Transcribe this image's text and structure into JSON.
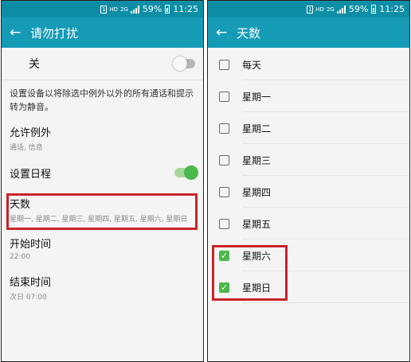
{
  "status_bar": {
    "sim": "1",
    "hd": "HD",
    "net": "2G",
    "battery": "59%",
    "time": "11:25"
  },
  "left_screen": {
    "title": "请勿打扰",
    "main_switch": {
      "label": "关",
      "on": false
    },
    "description": "设置设备以将除选中例外以外的所有通话和提示转为静音。",
    "exceptions": {
      "title": "允许例外",
      "summary": "通话, 信息"
    },
    "schedule": {
      "title": "设置日程",
      "on": true
    },
    "days": {
      "title": "天数",
      "summary": "星期一, 星期二, 星期三, 星期四, 星期五, 星期六, 星期日"
    },
    "start_time": {
      "title": "开始时间",
      "summary": "22:00"
    },
    "end_time": {
      "title": "结束时间",
      "summary": "次日 07:00"
    }
  },
  "right_screen": {
    "title": "天数",
    "items": [
      {
        "label": "每天",
        "checked": false
      },
      {
        "label": "星期一",
        "checked": false
      },
      {
        "label": "星期二",
        "checked": false
      },
      {
        "label": "星期三",
        "checked": false
      },
      {
        "label": "星期四",
        "checked": false
      },
      {
        "label": "星期五",
        "checked": false
      },
      {
        "label": "星期六",
        "checked": true
      },
      {
        "label": "星期日",
        "checked": true
      }
    ]
  },
  "colors": {
    "status_bar": "#0d8ea6",
    "toolbar": "#159bb6",
    "toggle_on": "#4bb84b",
    "highlight": "#c9232a"
  },
  "icons": {
    "back": "back-arrow-icon",
    "checkbox": "checkbox-icon",
    "checkmark": "checkmark-icon"
  }
}
